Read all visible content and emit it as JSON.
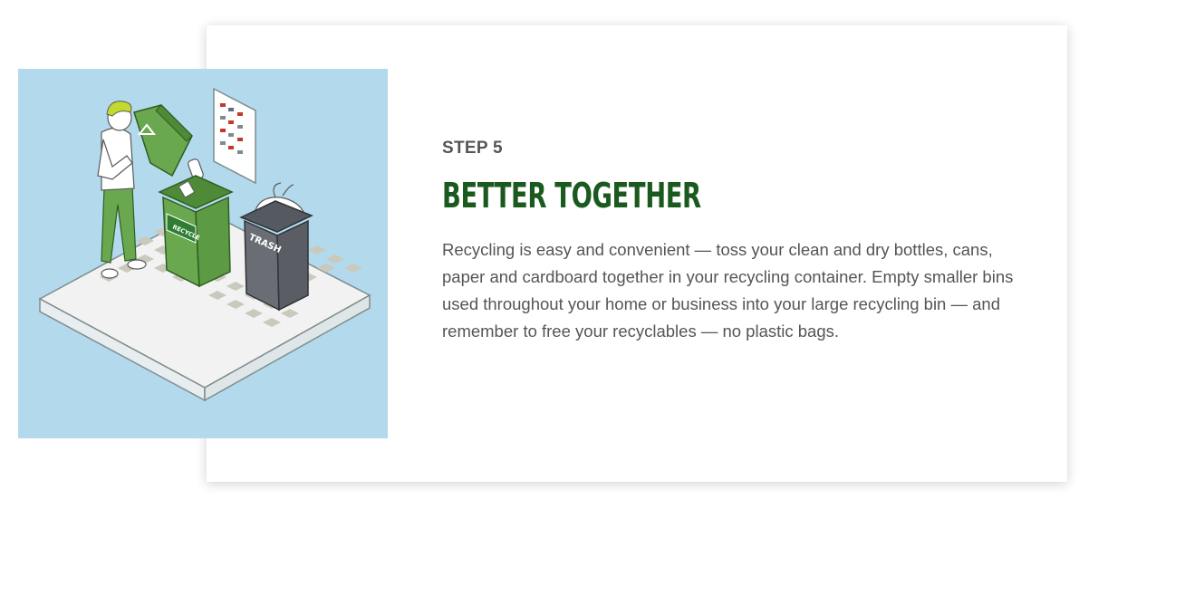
{
  "step": {
    "label": "STEP 5",
    "title": "BETTER TOGETHER",
    "body": "Recycling is easy and convenient — toss your clean and dry bottles, cans, paper and cardboard together in your recycling container. Empty smaller bins used throughout your home or business into your large recycling bin — and remember to free your recyclables — no plastic bags."
  },
  "illustration": {
    "recycle_bin_label": "RECYCLE",
    "trash_bin_label": "TRASH"
  },
  "colors": {
    "title": "#1b5a1e",
    "text": "#555555",
    "illustration_bg": "#b3d9ec",
    "recycle_green": "#6aa84f",
    "trash_gray": "#666a70"
  }
}
